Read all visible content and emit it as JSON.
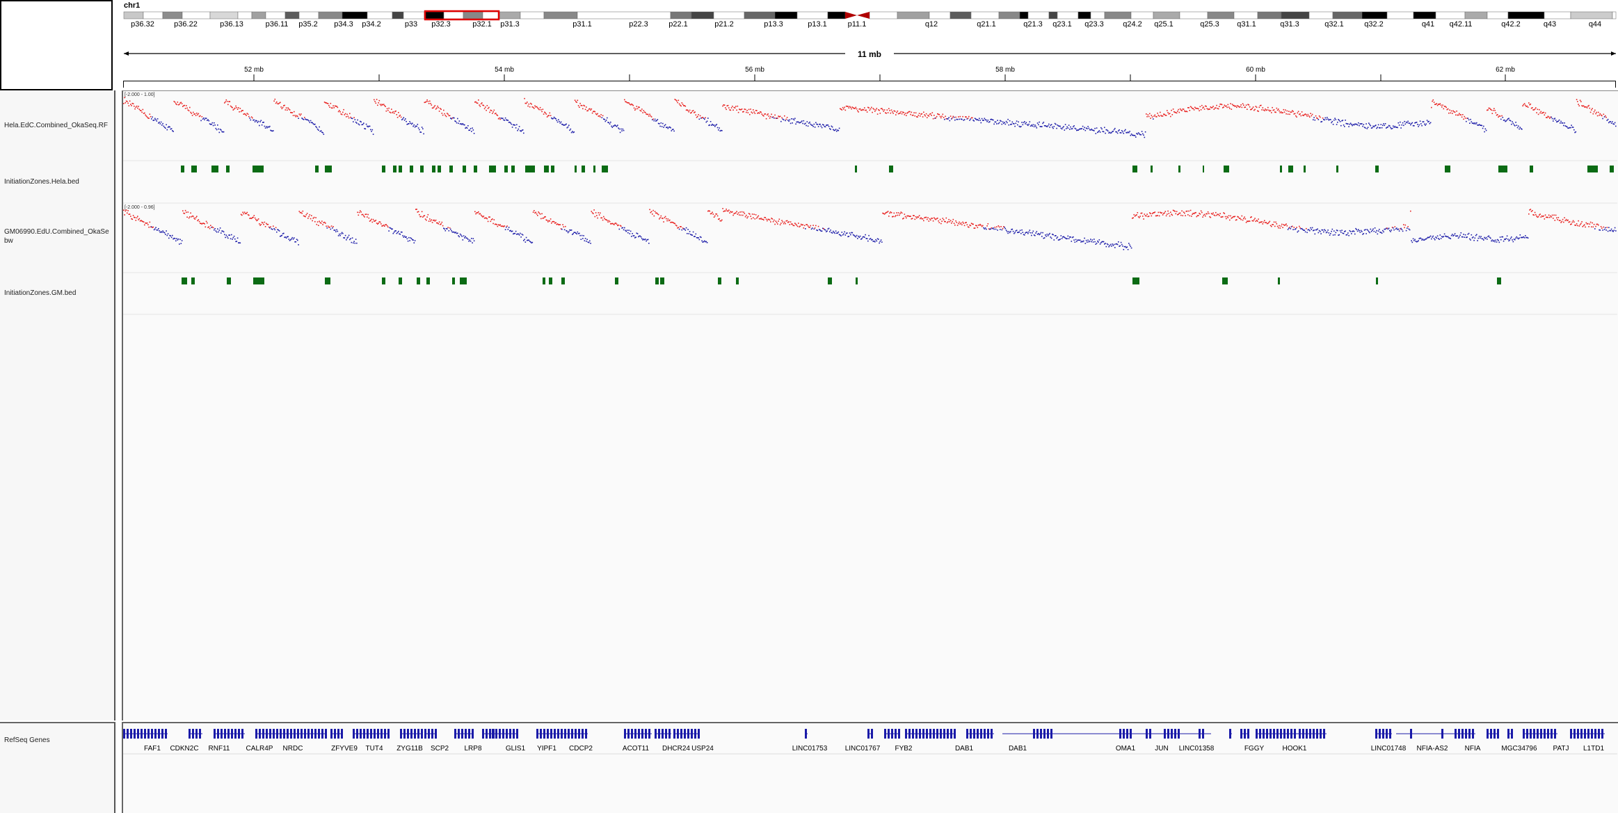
{
  "chromosome": "chr1",
  "span_label": "11 mb",
  "cytobands": [
    "p36.32",
    "p36.22",
    "p36.13",
    "p36.11",
    "p35.2",
    "p34.3",
    "p34.2",
    "p33",
    "p32.3",
    "p32.1",
    "p31.3",
    "p31.1",
    "p22.3",
    "p22.1",
    "p21.2",
    "p13.3",
    "p13.1",
    "p11.1",
    "q12",
    "q21.1",
    "q21.3",
    "q23.1",
    "q23.3",
    "q24.2",
    "q25.1",
    "q25.3",
    "q31.1",
    "q31.3",
    "q32.1",
    "q32.2",
    "q41",
    "q42.11",
    "q42.2",
    "q43",
    "q44"
  ],
  "ruler_ticks": [
    "52 mb",
    "54 mb",
    "56 mb",
    "58 mb",
    "60 mb",
    "62 mb"
  ],
  "tracks": {
    "hela_signal": {
      "name": "Hela.EdC.Combined_OkaSeq.RF",
      "range": "[-2.000 - 1.00]"
    },
    "hela_bed": {
      "name": "InitiationZones.Hela.bed"
    },
    "gm_signal": {
      "name": "GM06990.EdU.Combined_OkaSe\nbw",
      "range": "[-2.000 - 0.96]"
    },
    "gm_bed": {
      "name": "InitiationZones.GM.bed"
    },
    "refseq": {
      "name": "RefSeq Genes"
    }
  },
  "genes": [
    "FAF1",
    "CDKN2C",
    "RNF11",
    "CALR4P",
    "NRDC",
    "ZFYVE9",
    "TUT4",
    "ZYG11B",
    "SCP2",
    "LRP8",
    "GLIS1",
    "YIPF1",
    "CDCP2",
    "ACOT11",
    "DHCR24",
    "USP24",
    "LINC01753",
    "LINC01767",
    "FYB2",
    "DAB1",
    "DAB1",
    "OMA1",
    "JUN",
    "LINC01358",
    "FGGY",
    "HOOK1",
    "LINC01748",
    "NFIA-AS2",
    "NFIA",
    "MGC34796",
    "PATJ",
    "L1TD1"
  ],
  "colors": {
    "positive": "#e8201e",
    "negative": "#1b1ba8",
    "bed": "#0b6b14",
    "gene": "#1a1aa8",
    "highlight": "#e00000"
  }
}
